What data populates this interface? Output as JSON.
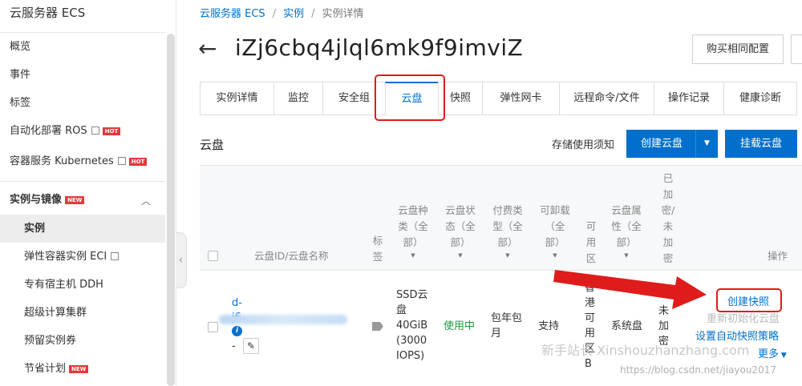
{
  "sidebar": {
    "title": "云服务器 ECS",
    "items": [
      {
        "label": "概览"
      },
      {
        "label": "事件"
      },
      {
        "label": "标签"
      },
      {
        "label": "自动化部署 ROS",
        "badge": "HOT"
      },
      {
        "label": "容器服务 Kubernetes",
        "badge": "HOT"
      }
    ],
    "group": {
      "label": "实例与镜像",
      "badge": "NEW"
    },
    "sub_items": [
      {
        "label": "实例"
      },
      {
        "label": "弹性容器实例 ECI"
      },
      {
        "label": "专有宿主机 DDH"
      },
      {
        "label": "超级计算集群"
      },
      {
        "label": "预留实例券"
      },
      {
        "label": "节省计划",
        "badge": "NEW"
      }
    ]
  },
  "breadcrumb": [
    "云服务器 ECS",
    "实例",
    "实例详情"
  ],
  "instance_title": "iZj6cbq4jlql6mk9f9imviZ",
  "buy_same_config": "购买相同配置",
  "tabs": [
    "实例详情",
    "监控",
    "安全组",
    "云盘",
    "快照",
    "弹性网卡",
    "远程命令/文件",
    "操作记录",
    "健康诊断"
  ],
  "active_tab": "云盘",
  "section_title": "云盘",
  "storage_notice": "存储使用须知",
  "create_disk": "创建云盘",
  "mount_disk": "挂载云盘",
  "table": {
    "headers": {
      "id": "云盘ID/云盘名称",
      "tag": "标签",
      "type": [
        "云盘种",
        "类（全",
        "部）"
      ],
      "status": [
        "云盘状",
        "态（全",
        "部）"
      ],
      "billing": [
        "付费类",
        "型（全",
        "部）"
      ],
      "detachable": [
        "可卸载",
        "（全",
        "部）"
      ],
      "zone": [
        "可",
        "用",
        "区"
      ],
      "attr": [
        "云盘属",
        "性（全",
        "部）"
      ],
      "encrypted": [
        "已",
        "加",
        "密/",
        "未",
        "加",
        "密"
      ],
      "ops": "操作"
    },
    "row": {
      "id_prefix": "d-",
      "id_line2": "j6",
      "name_line": "-",
      "type": [
        "SSD云",
        "盘",
        "40GiB",
        "(3000",
        "IOPS)"
      ],
      "status": "使用中",
      "billing": [
        "包年包",
        "月"
      ],
      "detachable": "支持",
      "zone": [
        "香",
        "港",
        "可",
        "用",
        "区",
        "B"
      ],
      "attr": "系统盘",
      "encrypted": [
        "未",
        "加",
        "密"
      ],
      "actions": {
        "create_snapshot": "创建快照",
        "reinit": "重新初始化云盘",
        "auto_snapshot": "设置自动快照策略",
        "more": "更多"
      }
    }
  },
  "watermarks": [
    "新手站长 Xinshouzhanzhang.com",
    "https://blog.csdn.net/jiayou2017"
  ],
  "colors": {
    "primary": "#0070cc",
    "highlight": "#e01b1b",
    "status_ok": "#1a9c3c",
    "hot": "#e4393c"
  }
}
